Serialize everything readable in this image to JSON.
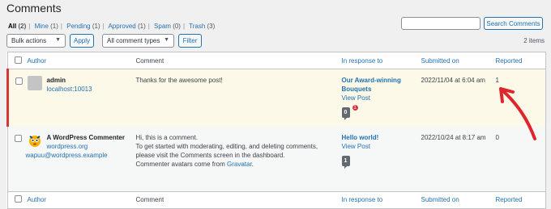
{
  "page_title": "Comments",
  "filters": [
    {
      "label": "All",
      "count": "(2)",
      "current": true
    },
    {
      "label": "Mine",
      "count": "(1)"
    },
    {
      "label": "Pending",
      "count": "(1)"
    },
    {
      "label": "Approved",
      "count": "(1)"
    },
    {
      "label": "Spam",
      "count": "(0)"
    },
    {
      "label": "Trash",
      "count": "(3)"
    }
  ],
  "search": {
    "button": "Search Comments",
    "value": ""
  },
  "toolbar": {
    "bulk_actions": "Bulk actions",
    "apply": "Apply",
    "comment_types": "All comment types",
    "filter": "Filter",
    "items_count": "2 items"
  },
  "columns": {
    "author": "Author",
    "comment": "Comment",
    "in_response_to": "In response to",
    "submitted_on": "Submitted on",
    "reported": "Reported"
  },
  "rows": [
    {
      "author_name": "admin",
      "author_url": "localhost:10013",
      "author_email": "",
      "comment_lines": [
        "Thanks for the awesome post!"
      ],
      "response_title_1": "Our Award-winning",
      "response_title_2": "Bouquets",
      "view_post": "View Post",
      "approved_count": "0",
      "pending_count": "1",
      "submitted": "2022/11/04 at 6:04 am",
      "reported": "1"
    },
    {
      "author_name": "A WordPress Commenter",
      "author_url": "wordpress.org",
      "author_email": "wapuu@wordpress.example",
      "comment_lines": [
        "Hi, this is a comment.",
        "To get started with moderating, editing, and deleting comments,",
        "please visit the Comments screen in the dashboard.",
        "Commenter avatars come from "
      ],
      "comment_link": "Gravatar",
      "comment_tail": ".",
      "response_title_1": "Hello world!",
      "view_post": "View Post",
      "approved_count": "1",
      "submitted": "2022/10/24 at 8:17 am",
      "reported": "0"
    }
  ],
  "colors": {
    "accent": "#2271b1",
    "pending_border": "#d63638",
    "arrow": "#e0262d"
  }
}
